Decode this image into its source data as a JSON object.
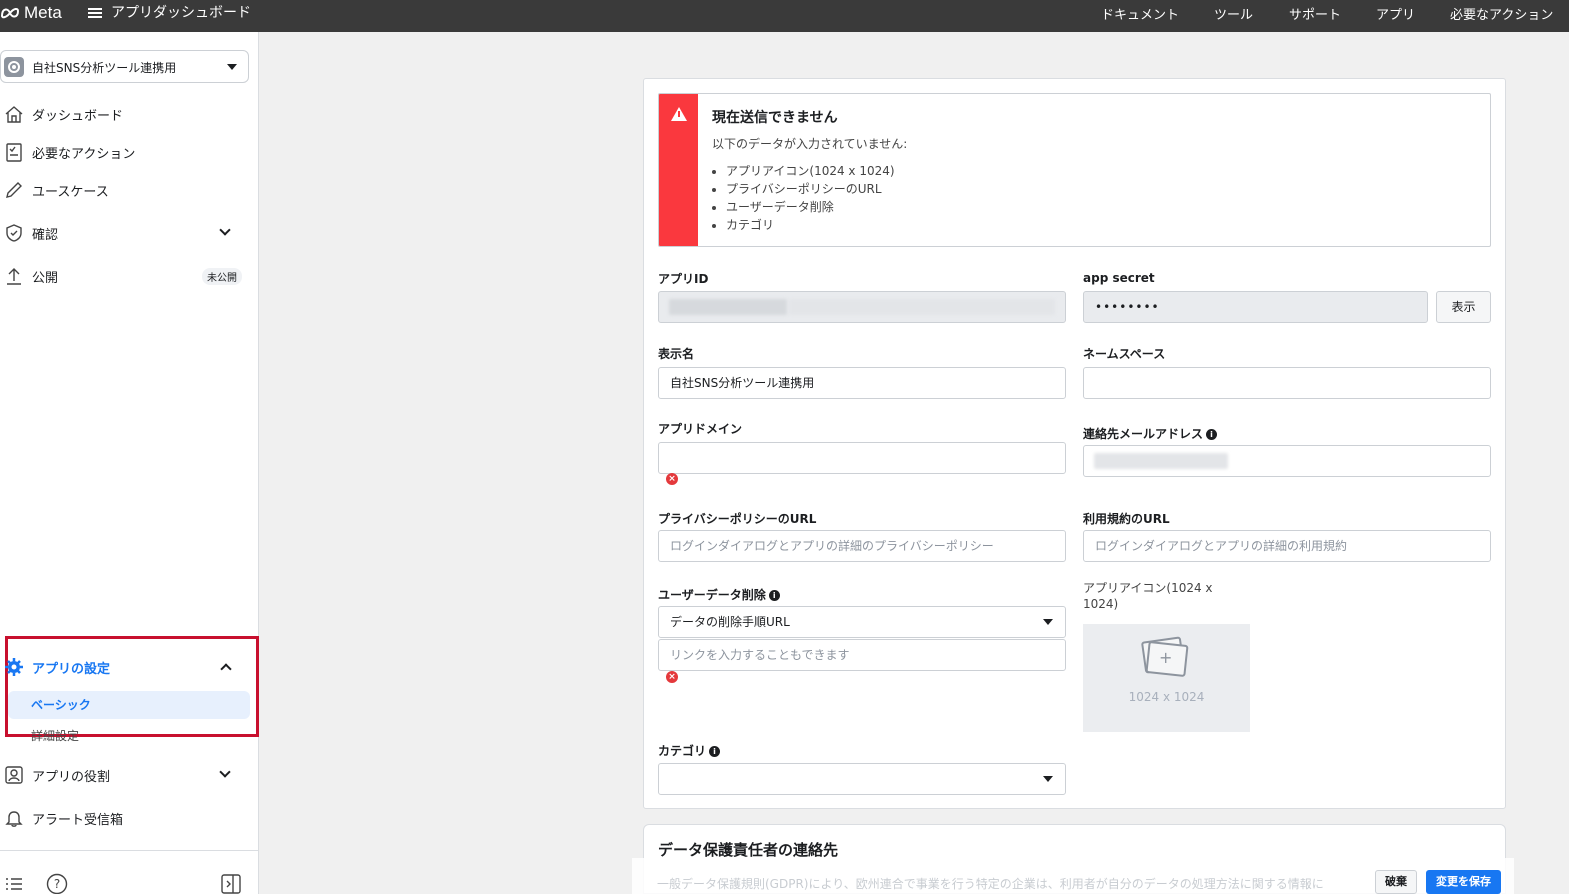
{
  "topbar": {
    "logo": "Meta",
    "title": "アプリダッシュボード",
    "nav": [
      "ドキュメント",
      "ツール",
      "サポート",
      "アプリ",
      "必要なアクション"
    ]
  },
  "sidebar": {
    "app_name": "自社SNS分析ツール連携用",
    "items": [
      {
        "label": "ダッシュボード",
        "icon": "home-icon"
      },
      {
        "label": "必要なアクション",
        "icon": "checklist-icon"
      },
      {
        "label": "ユースケース",
        "icon": "pencil-icon"
      },
      {
        "label": "確認",
        "icon": "shield-check-icon"
      },
      {
        "label": "公開",
        "icon": "upload-icon",
        "badge": "未公開"
      }
    ],
    "settings": {
      "label": "アプリの設定",
      "sub": [
        "ベーシック",
        "詳細設定"
      ]
    },
    "roles": "アプリの役割",
    "alerts": "アラート受信箱"
  },
  "alert": {
    "title": "現在送信できません",
    "subtitle": "以下のデータが入力されていません:",
    "items": [
      "アプリアイコン(1024 x 1024)",
      "プライバシーポリシーのURL",
      "ユーザーデータ削除",
      "カテゴリ"
    ]
  },
  "form": {
    "app_id_label": "アプリID",
    "app_secret_label": "app secret",
    "app_secret_value": "••••••••",
    "show_label": "表示",
    "display_name_label": "表示名",
    "display_name_value": "自社SNS分析ツール連携用",
    "namespace_label": "ネームスペース",
    "app_domain_label": "アプリドメイン",
    "contact_email_label": "連絡先メールアドレス",
    "privacy_label": "プライバシーポリシーのURL",
    "privacy_placeholder": "ログインダイアログとアプリの詳細のプライバシーポリシー",
    "terms_label": "利用規約のURL",
    "terms_placeholder": "ログインダイアログとアプリの詳細の利用規約",
    "user_data_label": "ユーザーデータ削除",
    "user_data_select": "データの削除手順URL",
    "user_data_placeholder": "リンクを入力することもできます",
    "app_icon_label": "アプリアイコン(1024 x 1024)",
    "app_icon_size": "1024 x 1024",
    "category_label": "カテゴリ"
  },
  "data_protection": {
    "title": "データ保護責任者の連絡先",
    "text": "一般データ保護規則(GDPR)により、欧州連合で事業を行う特定の企業は、利用者が自分のデータの処理方法に関する情報に",
    "discard": "破棄",
    "save": "変更を保存"
  }
}
